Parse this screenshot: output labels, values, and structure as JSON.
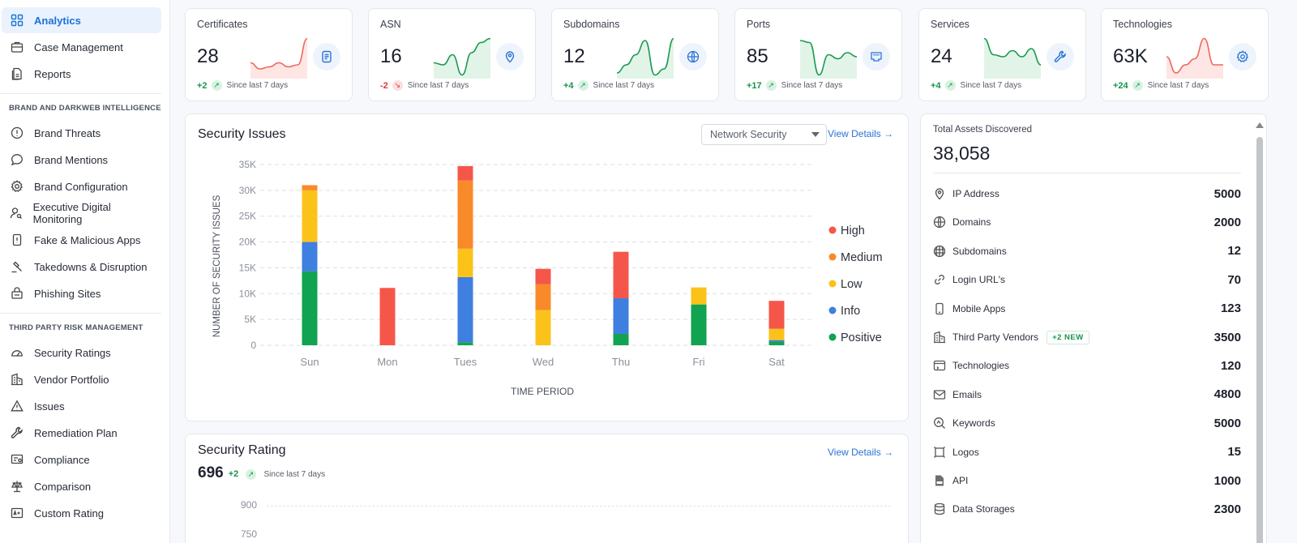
{
  "sidebar": {
    "items_top": [
      {
        "label": "Analytics",
        "icon": "grid-icon"
      },
      {
        "label": "Case Management",
        "icon": "briefcase-icon"
      },
      {
        "label": "Reports",
        "icon": "report-icon"
      }
    ],
    "section1_title": "BRAND AND DARKWEB INTELLIGENCE",
    "section1_items": [
      {
        "label": "Brand Threats",
        "icon": "alert-circle-icon"
      },
      {
        "label": "Brand Mentions",
        "icon": "chat-icon"
      },
      {
        "label": "Brand Configuration",
        "icon": "gear-icon"
      },
      {
        "label": "Executive Digital Monitoring",
        "icon": "user-search-icon"
      },
      {
        "label": "Fake & Malicious Apps",
        "icon": "phone-alert-icon"
      },
      {
        "label": "Takedowns & Disruption",
        "icon": "gavel-icon"
      },
      {
        "label": "Phishing Sites",
        "icon": "hook-icon"
      }
    ],
    "section2_title": "THIRD PARTY RISK MANAGEMENT",
    "section2_items": [
      {
        "label": "Security Ratings",
        "icon": "gauge-icon"
      },
      {
        "label": "Vendor Portfolio",
        "icon": "building-icon"
      },
      {
        "label": "Issues",
        "icon": "warning-icon"
      },
      {
        "label": "Remediation Plan",
        "icon": "wrench-icon"
      },
      {
        "label": "Compliance",
        "icon": "compliance-icon"
      },
      {
        "label": "Comparison",
        "icon": "scale-icon"
      },
      {
        "label": "Custom Rating",
        "icon": "rating-icon"
      }
    ]
  },
  "stats": [
    {
      "title": "Certificates",
      "value": "28",
      "delta": "+2",
      "direction": "up",
      "since": "Since last 7 days",
      "spark_color": "#f1665a",
      "icon": "document-icon",
      "spark": [
        0.35,
        0.2,
        0.25,
        0.35,
        0.25,
        0.3,
        0.95
      ]
    },
    {
      "title": "ASN",
      "value": "16",
      "delta": "-2",
      "direction": "down",
      "since": "Since last 7 days",
      "spark_color": "#1a9a50",
      "icon": "location-pin-icon",
      "spark": [
        0.35,
        0.3,
        0.55,
        0.05,
        0.6,
        0.85,
        0.95
      ]
    },
    {
      "title": "Subdomains",
      "value": "12",
      "delta": "+4",
      "direction": "up",
      "since": "Since last 7 days",
      "spark_color": "#1a9a50",
      "icon": "globe-icon",
      "spark": [
        0.1,
        0.3,
        0.55,
        0.9,
        0.05,
        0.2,
        0.95
      ]
    },
    {
      "title": "Ports",
      "value": "85",
      "delta": "+17",
      "direction": "up",
      "since": "Since last 7 days",
      "spark_color": "#1a9a50",
      "icon": "ethernet-port-icon",
      "spark": [
        0.9,
        0.85,
        0.05,
        0.55,
        0.45,
        0.6,
        0.5
      ]
    },
    {
      "title": "Services",
      "value": "24",
      "delta": "+4",
      "direction": "up",
      "since": "Since last 7 days",
      "spark_color": "#1a9a50",
      "icon": "wrench-icon",
      "spark": [
        0.95,
        0.55,
        0.5,
        0.65,
        0.5,
        0.7,
        0.3
      ]
    },
    {
      "title": "Technologies",
      "value": "63K",
      "delta": "+24",
      "direction": "up",
      "since": "Since last 7 days",
      "spark_color": "#f1665a",
      "icon": "gear-icon",
      "spark": [
        0.5,
        0.1,
        0.3,
        0.45,
        0.95,
        0.3,
        0.3
      ]
    }
  ],
  "security_issues": {
    "title": "Security Issues",
    "dropdown_value": "Network Security",
    "view_details": "View Details"
  },
  "security_rating": {
    "title": "Security Rating",
    "value": "696",
    "delta": "+2",
    "since": "Since last 7 days",
    "view_details": "View Details",
    "y_ticks": [
      "900",
      "750"
    ]
  },
  "assets": {
    "title": "Total Assets Discovered",
    "total": "38,058",
    "items": [
      {
        "label": "IP Address",
        "value": "5000",
        "icon": "location-pin-icon"
      },
      {
        "label": "Domains",
        "value": "2000",
        "icon": "globe-icon"
      },
      {
        "label": "Subdomains",
        "value": "12",
        "icon": "globe-grid-icon"
      },
      {
        "label": "Login URL's",
        "value": "70",
        "icon": "link-icon"
      },
      {
        "label": "Mobile Apps",
        "value": "123",
        "icon": "mobile-icon"
      },
      {
        "label": "Third Party Vendors",
        "value": "3500",
        "icon": "building-icon",
        "badge": "+2 NEW"
      },
      {
        "label": "Technologies",
        "value": "120",
        "icon": "browser-icon"
      },
      {
        "label": "Emails",
        "value": "4800",
        "icon": "mail-icon"
      },
      {
        "label": "Keywords",
        "value": "5000",
        "icon": "keyword-search-icon"
      },
      {
        "label": "Logos",
        "value": "15",
        "icon": "logo-frame-icon"
      },
      {
        "label": "API",
        "value": "1000",
        "icon": "api-file-icon"
      },
      {
        "label": "Data Storages",
        "value": "2300",
        "icon": "database-icon"
      }
    ]
  },
  "chart_data": {
    "type": "bar",
    "stacked": true,
    "title": "",
    "xlabel": "TIME PERIOD",
    "ylabel": "NUMBER OF SECURITY ISSUES",
    "categories": [
      "Sun",
      "Mon",
      "Tues",
      "Wed",
      "Thu",
      "Fri",
      "Sat"
    ],
    "ylim": [
      0,
      35000
    ],
    "yticks": [
      0,
      5000,
      10000,
      15000,
      20000,
      25000,
      30000,
      35000
    ],
    "ytick_labels": [
      "0",
      "5K",
      "10K",
      "15K",
      "20K",
      "25K",
      "30K",
      "35K"
    ],
    "grid": true,
    "legend_position": "right",
    "series": [
      {
        "name": "Positive",
        "color": "#10a350",
        "values": [
          14300,
          0,
          600,
          0,
          2200,
          7900,
          700
        ]
      },
      {
        "name": "Info",
        "color": "#3f7fe0",
        "values": [
          5700,
          0,
          12600,
          0,
          6900,
          0,
          300
        ]
      },
      {
        "name": "Low",
        "color": "#fbc21a",
        "values": [
          10000,
          0,
          5500,
          6800,
          0,
          3300,
          2200
        ]
      },
      {
        "name": "Medium",
        "color": "#f98a2a",
        "values": [
          1000,
          0,
          13200,
          5000,
          0,
          0,
          0
        ]
      },
      {
        "name": "High",
        "color": "#f5564a",
        "values": [
          0,
          11100,
          2800,
          3000,
          9000,
          0,
          5400
        ]
      }
    ],
    "legend_order": [
      "High",
      "Medium",
      "Low",
      "Info",
      "Positive"
    ]
  }
}
